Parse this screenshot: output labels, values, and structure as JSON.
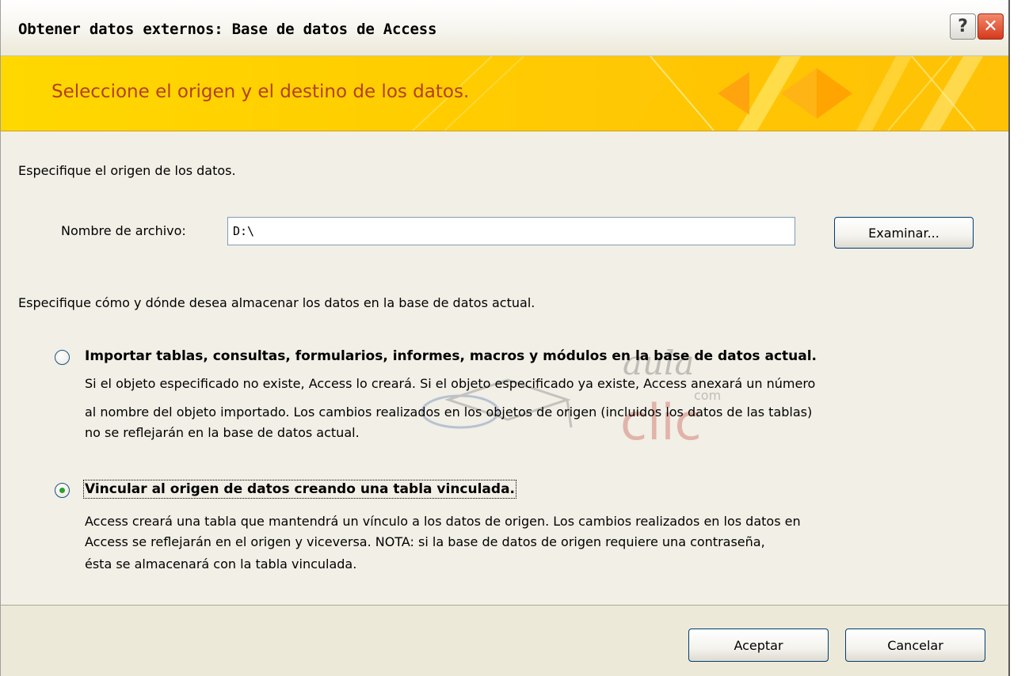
{
  "window": {
    "title": "Obtener datos externos: Base de datos de Access",
    "help_glyph": "?",
    "close_glyph": "✕"
  },
  "banner": {
    "heading": "Seleccione el origen y el destino de los datos."
  },
  "source": {
    "prompt": "Especifique el origen de los datos.",
    "file_label": "Nombre de archivo:",
    "file_value": "D:\\",
    "browse_label": "Examinar..."
  },
  "storage": {
    "prompt": "Especifique cómo y dónde desea almacenar los datos en la base de datos actual.",
    "options": [
      {
        "label": "Importar tablas, consultas, formularios, informes, macros y módulos en la base de datos actual.",
        "selected": false,
        "description": [
          "Si el objeto especificado no existe, Access lo creará. Si el objeto especificado ya existe, Access anexará un número",
          "al nombre del objeto importado. Los cambios realizados en los objetos de origen (incluidos los datos de las tablas)",
          "no se reflejarán en la base de datos actual."
        ]
      },
      {
        "label": "Vincular al origen de datos creando una tabla vinculada.",
        "selected": true,
        "description": [
          "Access creará una tabla que mantendrá un vínculo a los datos de origen. Los cambios realizados en los datos en",
          "Access se reflejarán en el origen y viceversa. NOTA: si la base de datos de origen requiere una contraseña,",
          "ésta se almacenará con la tabla vinculada."
        ]
      }
    ]
  },
  "footer": {
    "ok_label": "Aceptar",
    "cancel_label": "Cancelar"
  },
  "watermark": {
    "text_top": "aula",
    "text_mid": "com",
    "text_bottom": "clic"
  },
  "colors": {
    "banner_text": "#b2401a",
    "banner_bg": "#ffcc00",
    "radio_selected": "#2ba02b",
    "close_button": "#d6381a"
  }
}
